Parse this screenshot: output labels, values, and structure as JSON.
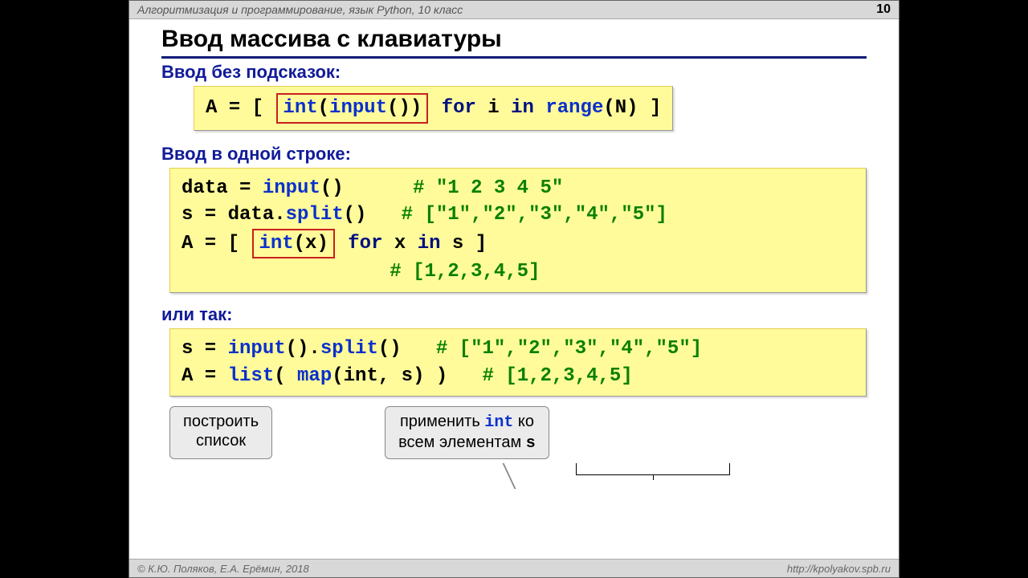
{
  "header": {
    "title": "Алгоритмизация и программирование, язык Python, 10 класс",
    "page": "10"
  },
  "main_title": "Ввод массива с клавиатуры",
  "section1": {
    "heading": "Ввод без подсказок:"
  },
  "code1": {
    "pre": "A = [ ",
    "box": "int(input())",
    "post1": " for i in range(N) ]",
    "kw_for": "for",
    "kw_in": "in",
    "fn_input": "input",
    "fn_int": "int",
    "fn_range": "range"
  },
  "section2": {
    "heading": "Ввод в одной строке:"
  },
  "code2": {
    "l1a": "data = ",
    "l1b": "input",
    "l1c": "()      ",
    "l1d": "# \"1 2 3 4 5\"",
    "l2a": "s = data.",
    "l2b": "split",
    "l2c": "()   ",
    "l2d": "# [\"1\",\"2\",\"3\",\"4\",\"5\"]",
    "l3a": "A = [ ",
    "l3box": "int(x)",
    "l3b": " for x in s ]",
    "kw_for": "for",
    "kw_in": "in",
    "fn_int": "int",
    "l4": "                  # [1,2,3,4,5]"
  },
  "section3": {
    "heading": "или так:"
  },
  "code3": {
    "l1a": "s = ",
    "l1b": "input",
    "l1c": "().",
    "l1d": "split",
    "l1e": "()   ",
    "l1f": "# [\"1\",\"2\",\"3\",\"4\",\"5\"]",
    "l2a": "A = ",
    "l2b": "list",
    "l2c": "( ",
    "l2d": "map",
    "l2e": "(int, s) )   ",
    "l2f": "# [1,2,3,4,5]"
  },
  "callouts": {
    "c1": "построить\nсписок",
    "c2a": "применить ",
    "c2b": "int",
    "c2c": " ко\nвсем элементам ",
    "c2d": "s"
  },
  "footer": {
    "left": "© К.Ю. Поляков, Е.А. Ерёмин, 2018",
    "right": "http://kpolyakov.spb.ru"
  }
}
